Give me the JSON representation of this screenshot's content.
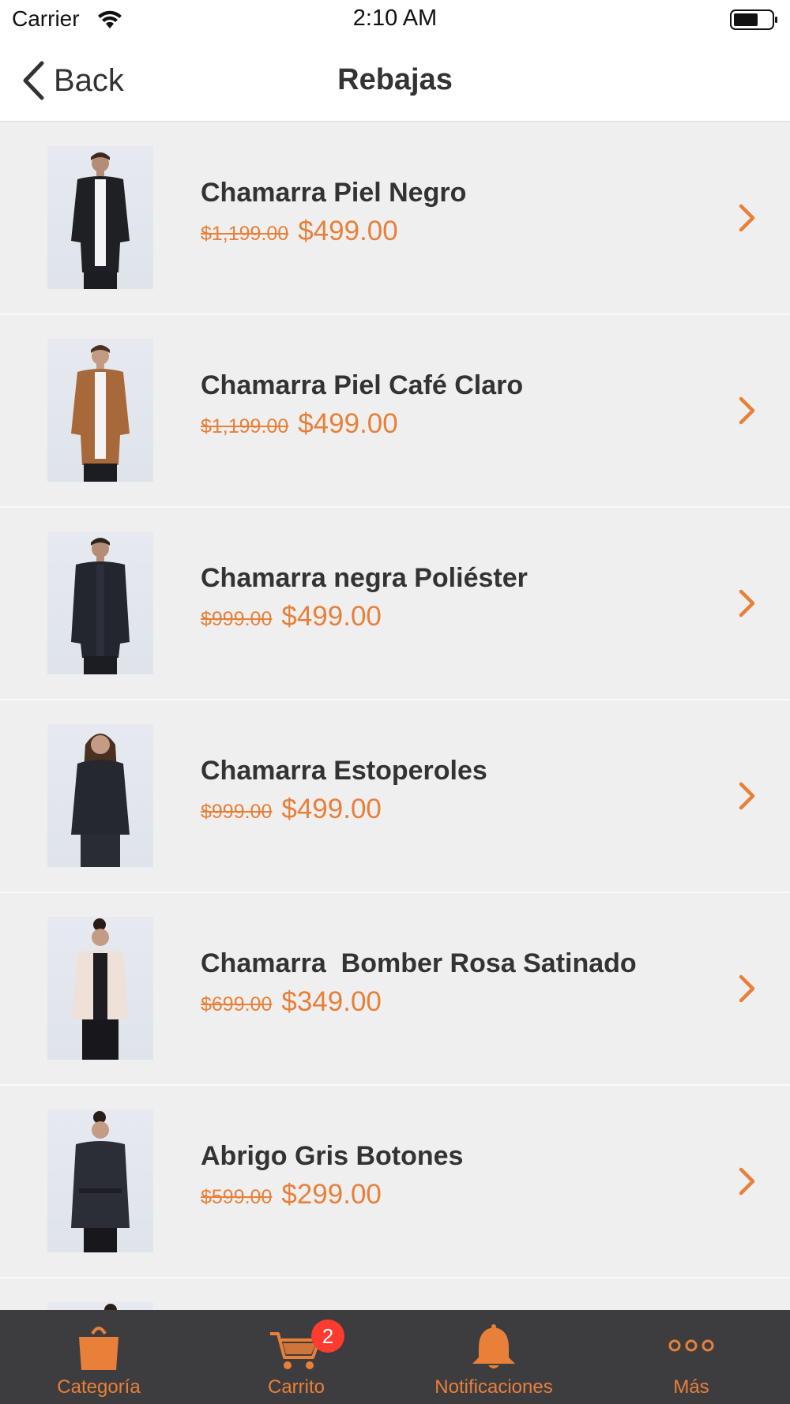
{
  "status_bar": {
    "carrier": "Carrier",
    "time": "2:10 AM"
  },
  "nav": {
    "back_label": "Back",
    "title": "Rebajas"
  },
  "products": [
    {
      "name": "Chamarra Piel Negro",
      "original_price": "$1,199.00",
      "sale_price": "$499.00"
    },
    {
      "name": "Chamarra Piel Café Claro",
      "original_price": "$1,199.00",
      "sale_price": "$499.00"
    },
    {
      "name": "Chamarra negra Poliéster",
      "original_price": "$999.00",
      "sale_price": "$499.00"
    },
    {
      "name": "Chamarra Estoperoles",
      "original_price": "$999.00",
      "sale_price": "$499.00"
    },
    {
      "name": "Chamarra  Bomber Rosa Satinado",
      "original_price": "$699.00",
      "sale_price": "$349.00"
    },
    {
      "name": "Abrigo Gris Botones",
      "original_price": "$599.00",
      "sale_price": "$299.00"
    }
  ],
  "tab_bar": {
    "tabs": [
      {
        "label": "Categoría",
        "icon": "shopping-bag-icon"
      },
      {
        "label": "Carrito",
        "icon": "cart-icon",
        "badge": "2"
      },
      {
        "label": "Notificaciones",
        "icon": "bell-icon"
      },
      {
        "label": "Más",
        "icon": "more-icon"
      }
    ]
  },
  "colors": {
    "accent": "#e8803a",
    "tab_bar_bg": "#3d3d3f",
    "list_bg": "#efefef",
    "badge": "#ff3b30"
  }
}
